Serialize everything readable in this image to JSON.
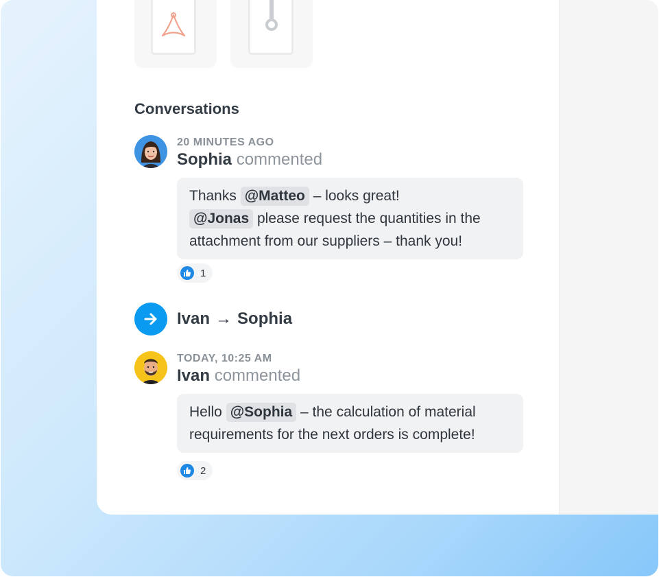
{
  "attachments": [
    {
      "type": "pdf",
      "icon": "pdf-icon"
    },
    {
      "type": "zip",
      "icon": "zip-icon"
    }
  ],
  "conversations": {
    "title": "Conversations",
    "comments": [
      {
        "time": "20 MINUTES AGO",
        "author": "Sophia",
        "verb": "commented",
        "text_parts": {
          "p1": "Thanks ",
          "m1": "@Matteo",
          "p2": " – looks great!",
          "m2": "@Jonas",
          "p3": " please request the quantities in the attachment from our suppliers – thank you!"
        },
        "likes": "1"
      },
      {
        "time": "TODAY, 10:25 AM",
        "author": "Ivan",
        "verb": "commented",
        "text_parts": {
          "p1": "Hello ",
          "m1": "@Sophia",
          "p2": " – the calculation of material requirements for the next orders is complete!"
        },
        "likes": "2"
      }
    ],
    "handoff": {
      "from": "Ivan",
      "arrow": "→",
      "to": "Sophia",
      "icon": "arrow-right-icon"
    }
  },
  "colors": {
    "accent": "#0a9af0",
    "like": "#1e88e5",
    "mention_bg": "#dfe1e4",
    "bubble_bg": "#f1f2f3"
  }
}
